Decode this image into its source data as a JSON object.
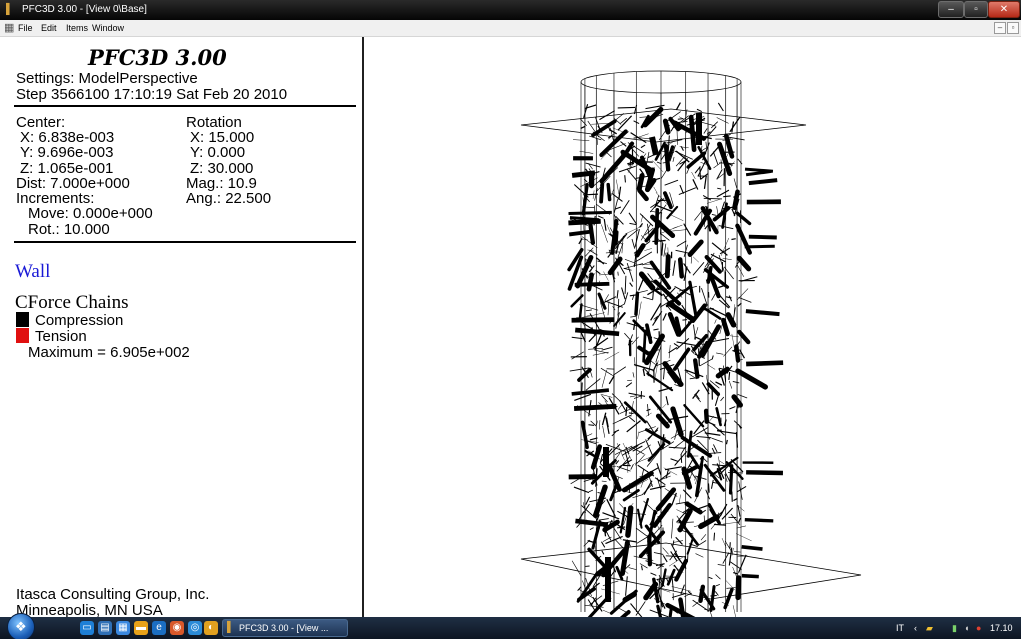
{
  "window": {
    "title": "PFC3D 3.00  - [View 0\\Base]",
    "min_glyph": "–",
    "max_glyph": "▫",
    "close_glyph": "✕"
  },
  "menu": {
    "items": [
      "File",
      "Edit",
      "Items",
      "Window"
    ],
    "mdi_min_glyph": "–",
    "mdi_restore_glyph": "▫"
  },
  "panel": {
    "heading": "PFC3D 3.00",
    "settings": "Settings:  ModelPerspective",
    "step": "Step 3566100  17:10:19 Sat Feb 20 2010",
    "center": {
      "label": "Center:",
      "x": "X: 6.838e-003",
      "y": "Y: 9.696e-003",
      "z": "Z: 1.065e-001"
    },
    "rotation": {
      "label": "Rotation",
      "x": "X:  15.000",
      "y": "Y:   0.000",
      "z": "Z:  30.000"
    },
    "dist": "Dist: 7.000e+000",
    "mag": "Mag.:      10.9",
    "increments": "Increments:",
    "ang": "Ang.:  22.500",
    "move": "Move: 0.000e+000",
    "rot": "Rot.:   10.000",
    "wall": "Wall",
    "cforce": {
      "title": "CForce Chains",
      "compression": "Compression",
      "tension": "Tension",
      "maximum": "Maximum =  6.905e+002",
      "compression_color": "#000000",
      "tension_color": "#e01010"
    },
    "footer": {
      "company": "Itasca Consulting Group, Inc.",
      "location": "Minneapolis, MN  USA"
    }
  },
  "viewport": {
    "content": "3D cylindrical specimen with contact force chain network"
  },
  "taskbar": {
    "start_icon": "windows-orb",
    "task_label": "PFC3D 3.00 - [View ...",
    "tray_lang": "IT",
    "tray_chevron": "‹",
    "tray_time": "17.10"
  }
}
